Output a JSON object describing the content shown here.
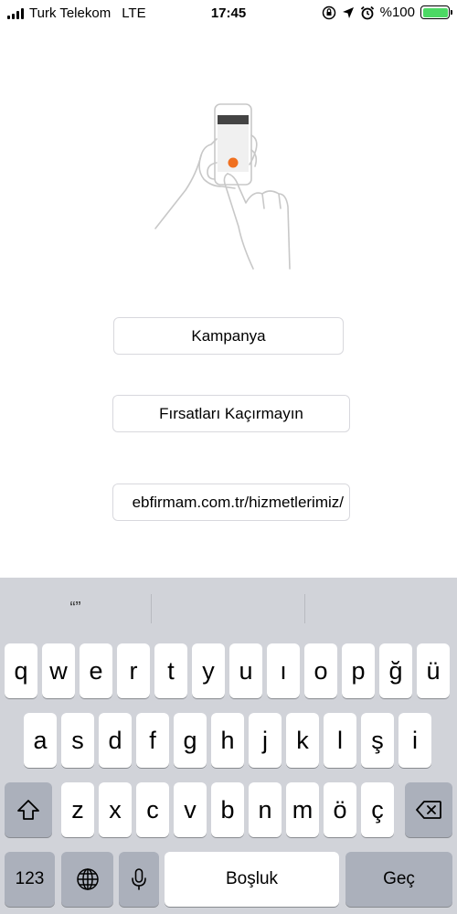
{
  "status_bar": {
    "carrier": "Turk Telekom",
    "network": "LTE",
    "time": "17:45",
    "battery_percent": "%100",
    "battery_level": 1.0,
    "icons": [
      "signal-icon",
      "orientation-lock-icon",
      "location-icon",
      "alarm-icon",
      "battery-icon"
    ]
  },
  "illustration": {
    "name": "hand-holding-phone-tap",
    "accent": "#f07020"
  },
  "fields": [
    {
      "value": "Kampanya"
    },
    {
      "value": "Fırsatları Kaçırmayın"
    },
    {
      "value": "ebfirmam.com.tr/hizmetlerimiz/"
    }
  ],
  "keyboard": {
    "predictive": [
      "“”",
      "",
      ""
    ],
    "row1": [
      "q",
      "w",
      "e",
      "r",
      "t",
      "y",
      "u",
      "ı",
      "o",
      "p",
      "ğ",
      "ü"
    ],
    "row2": [
      "a",
      "s",
      "d",
      "f",
      "g",
      "h",
      "j",
      "k",
      "l",
      "ş",
      "i"
    ],
    "row3": [
      "z",
      "x",
      "c",
      "v",
      "b",
      "n",
      "m",
      "ö",
      "ç"
    ],
    "numbers_label": "123",
    "space_label": "Boşluk",
    "return_label": "Geç"
  },
  "colors": {
    "keyboard_bg": "#d1d3d9",
    "battery_green": "#4cd964"
  }
}
